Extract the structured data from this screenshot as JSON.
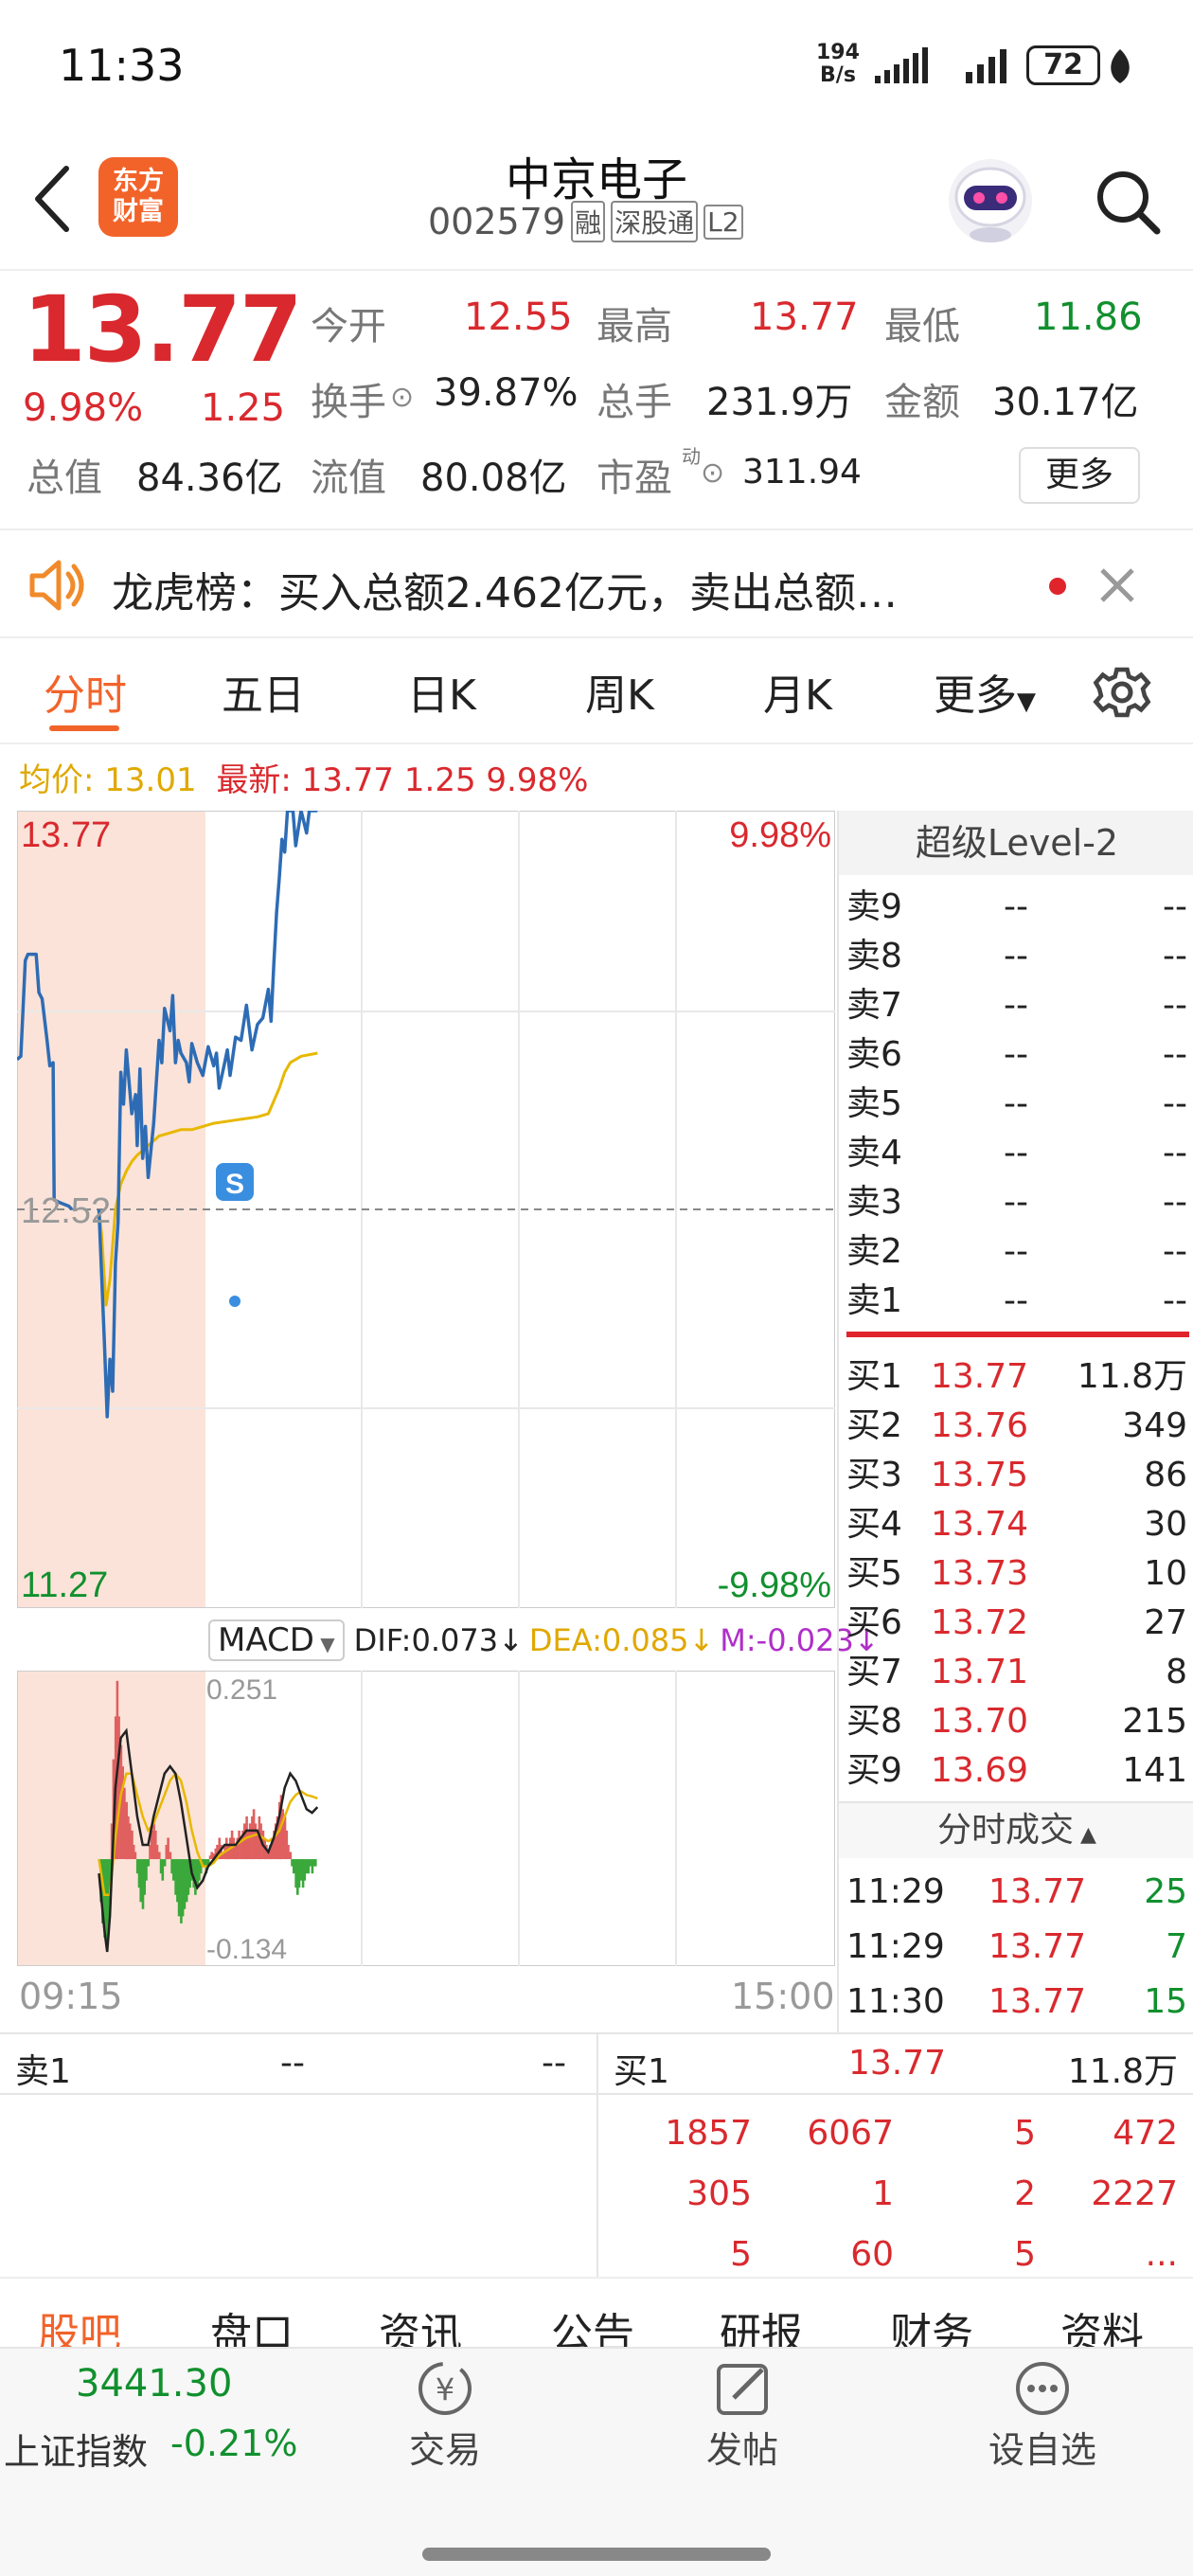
{
  "status": {
    "time": "11:33",
    "net_speed_num": "194",
    "net_speed_unit": "B/s",
    "battery": "72"
  },
  "header": {
    "title": "中京电子",
    "code": "002579",
    "tags": [
      "融",
      "深股通",
      "L2"
    ],
    "logo_line1": "东方",
    "logo_line2": "财富"
  },
  "quote": {
    "price": "13.77",
    "pct": "9.98%",
    "chg": "1.25",
    "open_label": "今开",
    "open": "12.55",
    "high_label": "最高",
    "high": "13.77",
    "low_label": "最低",
    "low": "11.86",
    "turnover_label": "换手",
    "turnover": "39.87%",
    "volume_label": "总手",
    "volume": "231.9万",
    "amount_label": "金额",
    "amount": "30.17亿",
    "mcap_label": "总值",
    "mcap": "84.36亿",
    "float_label": "流值",
    "float_cap": "80.08亿",
    "pe_label": "市盈",
    "pe_sup": "动",
    "pe": "311.94",
    "more_button": "更多"
  },
  "notice": {
    "text": "龙虎榜：买入总额2.462亿元，卖出总额…"
  },
  "tabs": {
    "items": [
      "分时",
      "五日",
      "日K",
      "周K",
      "月K"
    ],
    "more": "更多",
    "active_index": 0
  },
  "legend": {
    "avg_label": "均价:",
    "avg": "13.01",
    "latest_label": "最新:",
    "latest": "13.77",
    "chg": "1.25",
    "pct": "9.98%"
  },
  "chart_data": {
    "type": "line",
    "title": "",
    "price_axis": {
      "top": "13.77",
      "mid": "12.52",
      "bottom": "11.27",
      "top_pct": "9.98%",
      "bottom_pct": "-9.98%",
      "ylim": [
        11.27,
        13.77
      ],
      "prev_close": 12.52
    },
    "time_axis": {
      "start": "09:15",
      "end": "15:00"
    },
    "auction_price": [
      [
        0,
        12.99
      ],
      [
        0.7,
        13.0
      ],
      [
        1.5,
        13.3
      ],
      [
        2,
        13.32
      ],
      [
        3.5,
        13.32
      ],
      [
        4,
        13.2
      ],
      [
        4.6,
        13.18
      ],
      [
        5.5,
        13.05
      ],
      [
        6,
        12.97
      ],
      [
        6.6,
        12.98
      ],
      [
        6.8,
        12.55
      ],
      [
        8,
        12.54
      ],
      [
        9.5,
        12.53
      ],
      [
        10,
        12.52
      ]
    ],
    "price": [
      [
        15,
        12.52
      ],
      [
        16,
        12.1
      ],
      [
        16.5,
        11.87
      ],
      [
        17,
        12.05
      ],
      [
        17.5,
        11.95
      ],
      [
        18,
        12.35
      ],
      [
        18.5,
        12.48
      ],
      [
        19,
        12.95
      ],
      [
        19.5,
        12.85
      ],
      [
        20,
        13.02
      ],
      [
        21,
        12.82
      ],
      [
        21.7,
        12.88
      ],
      [
        22,
        12.72
      ],
      [
        22.5,
        12.96
      ],
      [
        23,
        12.68
      ],
      [
        23.5,
        12.78
      ],
      [
        24,
        12.62
      ],
      [
        25,
        12.79
      ],
      [
        26,
        13.05
      ],
      [
        26.5,
        12.98
      ],
      [
        27,
        13.15
      ],
      [
        28,
        13.08
      ],
      [
        28.5,
        13.19
      ],
      [
        29,
        12.98
      ],
      [
        29.5,
        13.05
      ],
      [
        30,
        13.01
      ],
      [
        31,
        12.98
      ],
      [
        31.5,
        12.92
      ],
      [
        32,
        13.04
      ],
      [
        33,
        12.98
      ],
      [
        34,
        12.94
      ],
      [
        35,
        13.03
      ],
      [
        36,
        12.97
      ],
      [
        36.5,
        13.01
      ],
      [
        37,
        12.9
      ],
      [
        38,
        12.98
      ],
      [
        38.5,
        13.02
      ],
      [
        39,
        12.94
      ],
      [
        40,
        13.06
      ],
      [
        41,
        13.05
      ],
      [
        42,
        13.16
      ],
      [
        43,
        13.02
      ],
      [
        44,
        13.1
      ],
      [
        45,
        13.12
      ],
      [
        46,
        13.21
      ],
      [
        46.5,
        13.11
      ],
      [
        47,
        13.29
      ],
      [
        47.5,
        13.45
      ],
      [
        48,
        13.56
      ],
      [
        48.5,
        13.68
      ],
      [
        49,
        13.64
      ],
      [
        49.5,
        13.77
      ],
      [
        50.5,
        13.77
      ],
      [
        51,
        13.66
      ],
      [
        52,
        13.77
      ],
      [
        53,
        13.7
      ],
      [
        53.5,
        13.77
      ],
      [
        55,
        13.77
      ]
    ],
    "avg_price": [
      [
        15,
        12.52
      ],
      [
        15.5,
        12.44
      ],
      [
        16,
        12.3
      ],
      [
        16.3,
        12.22
      ],
      [
        17,
        12.3
      ],
      [
        18,
        12.52
      ],
      [
        19,
        12.6
      ],
      [
        20,
        12.64
      ],
      [
        21,
        12.67
      ],
      [
        22,
        12.69
      ],
      [
        24,
        12.72
      ],
      [
        26,
        12.75
      ],
      [
        28,
        12.76
      ],
      [
        30,
        12.77
      ],
      [
        32,
        12.77
      ],
      [
        34,
        12.78
      ],
      [
        36,
        12.79
      ],
      [
        40,
        12.8
      ],
      [
        44,
        12.81
      ],
      [
        46,
        12.82
      ],
      [
        47,
        12.86
      ],
      [
        48,
        12.9
      ],
      [
        49,
        12.95
      ],
      [
        50,
        12.98
      ],
      [
        52,
        13.0
      ],
      [
        55,
        13.01
      ]
    ],
    "macd": {
      "label": "MACD",
      "dif_label": "DIF:",
      "dif": "0.073",
      "dea_label": "DEA:",
      "dea": "0.085",
      "m_label": "M:",
      "m": "-0.023",
      "top": "0.251",
      "bottom": "-0.134",
      "ylim": [
        -0.134,
        0.251
      ],
      "hist": [
        [
          15.3,
          -0.06
        ],
        [
          15.6,
          -0.09
        ],
        [
          16,
          -0.11
        ],
        [
          16.3,
          -0.12
        ],
        [
          16.6,
          -0.1
        ],
        [
          17,
          -0.06
        ],
        [
          17.3,
          0.05
        ],
        [
          17.6,
          0.14
        ],
        [
          18,
          0.2
        ],
        [
          18.3,
          0.25
        ],
        [
          18.6,
          0.2
        ],
        [
          19,
          0.16
        ],
        [
          19.3,
          0.13
        ],
        [
          19.6,
          0.1
        ],
        [
          20,
          0.08
        ],
        [
          20.3,
          0.06
        ],
        [
          20.6,
          0.05
        ],
        [
          21,
          0.04
        ],
        [
          21.3,
          0.02
        ],
        [
          21.6,
          0.01
        ],
        [
          22,
          -0.02
        ],
        [
          22.3,
          -0.04
        ],
        [
          22.6,
          -0.06
        ],
        [
          23,
          -0.07
        ],
        [
          23.3,
          -0.05
        ],
        [
          23.6,
          -0.03
        ],
        [
          24,
          -0.01
        ],
        [
          24.3,
          0.02
        ],
        [
          24.6,
          0.04
        ],
        [
          25,
          0.05
        ],
        [
          25.3,
          0.04
        ],
        [
          25.6,
          0.02
        ],
        [
          26,
          0.01
        ],
        [
          26.3,
          -0.02
        ],
        [
          26.6,
          -0.03
        ],
        [
          27,
          -0.01
        ],
        [
          27.3,
          0.02
        ],
        [
          27.6,
          0.03
        ],
        [
          28,
          0.01
        ],
        [
          28.3,
          -0.02
        ],
        [
          28.6,
          -0.03
        ],
        [
          29,
          -0.05
        ],
        [
          29.3,
          -0.06
        ],
        [
          29.6,
          -0.08
        ],
        [
          30,
          -0.09
        ],
        [
          30.3,
          -0.08
        ],
        [
          30.6,
          -0.07
        ],
        [
          31,
          -0.06
        ],
        [
          31.3,
          -0.05
        ],
        [
          31.6,
          -0.04
        ],
        [
          32,
          -0.03
        ],
        [
          32.3,
          -0.04
        ],
        [
          32.6,
          -0.05
        ],
        [
          33,
          -0.04
        ],
        [
          33.3,
          -0.03
        ],
        [
          33.6,
          -0.02
        ],
        [
          34,
          -0.01
        ],
        [
          34.3,
          -0.01
        ],
        [
          34.6,
          -0.02
        ],
        [
          35,
          -0.01
        ],
        [
          35.3,
          0.005
        ],
        [
          35.6,
          0.01
        ],
        [
          36,
          0.008
        ],
        [
          36.3,
          0.015
        ],
        [
          36.6,
          0.02
        ],
        [
          37,
          0.03
        ],
        [
          37.3,
          0.02
        ],
        [
          37.6,
          0.01
        ],
        [
          38,
          0.02
        ],
        [
          38.3,
          0.03
        ],
        [
          38.6,
          0.02
        ],
        [
          39,
          0.03
        ],
        [
          39.3,
          0.04
        ],
        [
          39.6,
          0.03
        ],
        [
          40,
          0.02
        ],
        [
          40.3,
          0.03
        ],
        [
          40.6,
          0.04
        ],
        [
          41,
          0.03
        ],
        [
          41.3,
          0.04
        ],
        [
          41.6,
          0.05
        ],
        [
          42,
          0.06
        ],
        [
          42.3,
          0.04
        ],
        [
          42.6,
          0.05
        ],
        [
          43,
          0.06
        ],
        [
          43.3,
          0.07
        ],
        [
          43.6,
          0.05
        ],
        [
          44,
          0.04
        ],
        [
          44.3,
          0.06
        ],
        [
          44.6,
          0.05
        ],
        [
          45,
          0.04
        ],
        [
          45.3,
          0.03
        ],
        [
          45.6,
          0.02
        ],
        [
          46,
          0.01
        ],
        [
          46.3,
          0.02
        ],
        [
          46.6,
          0.03
        ],
        [
          47,
          0.04
        ],
        [
          47.3,
          0.05
        ],
        [
          47.6,
          0.06
        ],
        [
          48,
          0.08
        ],
        [
          48.3,
          0.09
        ],
        [
          48.6,
          0.07
        ],
        [
          49,
          0.06
        ],
        [
          49.3,
          0.04
        ],
        [
          49.6,
          0.02
        ],
        [
          50,
          0.01
        ],
        [
          50.3,
          -0.01
        ],
        [
          50.6,
          -0.02
        ],
        [
          51,
          -0.04
        ],
        [
          51.3,
          -0.05
        ],
        [
          51.6,
          -0.04
        ],
        [
          52,
          -0.03
        ],
        [
          52.3,
          -0.04
        ],
        [
          52.6,
          -0.03
        ],
        [
          53,
          -0.02
        ],
        [
          53.3,
          -0.02
        ],
        [
          53.6,
          -0.01
        ],
        [
          54,
          -0.02
        ],
        [
          54.3,
          -0.01
        ],
        [
          54.6,
          -0.01
        ]
      ],
      "dif_line": [
        [
          15,
          -0.02
        ],
        [
          16,
          -0.1
        ],
        [
          16.5,
          -0.13
        ],
        [
          17,
          -0.08
        ],
        [
          18,
          0.1
        ],
        [
          19,
          0.17
        ],
        [
          20,
          0.18
        ],
        [
          21,
          0.12
        ],
        [
          22,
          0.06
        ],
        [
          23,
          0.02
        ],
        [
          24,
          0.02
        ],
        [
          25,
          0.06
        ],
        [
          26,
          0.09
        ],
        [
          27,
          0.12
        ],
        [
          28,
          0.13
        ],
        [
          29,
          0.12
        ],
        [
          30,
          0.08
        ],
        [
          31,
          0.03
        ],
        [
          32,
          -0.02
        ],
        [
          33,
          -0.04
        ],
        [
          34,
          -0.03
        ],
        [
          35,
          -0.01
        ],
        [
          36,
          0.0
        ],
        [
          37,
          0.01
        ],
        [
          38,
          0.02
        ],
        [
          40,
          0.02
        ],
        [
          42,
          0.04
        ],
        [
          44,
          0.04
        ],
        [
          45,
          0.02
        ],
        [
          46,
          0.01
        ],
        [
          47,
          0.03
        ],
        [
          48,
          0.06
        ],
        [
          49,
          0.1
        ],
        [
          50,
          0.12
        ],
        [
          51,
          0.11
        ],
        [
          52,
          0.09
        ],
        [
          53,
          0.07
        ],
        [
          54,
          0.065
        ],
        [
          55,
          0.073
        ]
      ],
      "dea_line": [
        [
          15,
          0.0
        ],
        [
          16,
          -0.05
        ],
        [
          17,
          -0.05
        ],
        [
          18,
          0.03
        ],
        [
          19,
          0.09
        ],
        [
          20,
          0.12
        ],
        [
          21,
          0.12
        ],
        [
          22,
          0.09
        ],
        [
          23,
          0.06
        ],
        [
          24,
          0.04
        ],
        [
          25,
          0.05
        ],
        [
          26,
          0.07
        ],
        [
          27,
          0.09
        ],
        [
          28,
          0.11
        ],
        [
          29,
          0.12
        ],
        [
          30,
          0.11
        ],
        [
          31,
          0.08
        ],
        [
          32,
          0.04
        ],
        [
          33,
          0.01
        ],
        [
          34,
          -0.01
        ],
        [
          35,
          -0.01
        ],
        [
          36,
          -0.005
        ],
        [
          37,
          0.005
        ],
        [
          38,
          0.01
        ],
        [
          40,
          0.02
        ],
        [
          42,
          0.03
        ],
        [
          44,
          0.035
        ],
        [
          45,
          0.03
        ],
        [
          46,
          0.025
        ],
        [
          47,
          0.03
        ],
        [
          48,
          0.04
        ],
        [
          49,
          0.06
        ],
        [
          50,
          0.08
        ],
        [
          51,
          0.09
        ],
        [
          52,
          0.095
        ],
        [
          53,
          0.09
        ],
        [
          54,
          0.088
        ],
        [
          55,
          0.085
        ]
      ]
    }
  },
  "order_book": {
    "title": "超级Level-2",
    "sells": [
      {
        "label": "卖9",
        "price": "--",
        "vol": "--"
      },
      {
        "label": "卖8",
        "price": "--",
        "vol": "--"
      },
      {
        "label": "卖7",
        "price": "--",
        "vol": "--"
      },
      {
        "label": "卖6",
        "price": "--",
        "vol": "--"
      },
      {
        "label": "卖5",
        "price": "--",
        "vol": "--"
      },
      {
        "label": "卖4",
        "price": "--",
        "vol": "--"
      },
      {
        "label": "卖3",
        "price": "--",
        "vol": "--"
      },
      {
        "label": "卖2",
        "price": "--",
        "vol": "--"
      },
      {
        "label": "卖1",
        "price": "--",
        "vol": "--"
      }
    ],
    "buys": [
      {
        "label": "买1",
        "price": "13.77",
        "vol": "11.8万"
      },
      {
        "label": "买2",
        "price": "13.76",
        "vol": "349"
      },
      {
        "label": "买3",
        "price": "13.75",
        "vol": "86"
      },
      {
        "label": "买4",
        "price": "13.74",
        "vol": "30"
      },
      {
        "label": "买5",
        "price": "13.73",
        "vol": "10"
      },
      {
        "label": "买6",
        "price": "13.72",
        "vol": "27"
      },
      {
        "label": "买7",
        "price": "13.71",
        "vol": "8"
      },
      {
        "label": "买8",
        "price": "13.70",
        "vol": "215"
      },
      {
        "label": "买9",
        "price": "13.69",
        "vol": "141"
      }
    ],
    "ticks_title": "分时成交",
    "ticks": [
      {
        "time": "11:29",
        "price": "13.77",
        "vol": "25"
      },
      {
        "time": "11:29",
        "price": "13.77",
        "vol": "7"
      },
      {
        "time": "11:30",
        "price": "13.77",
        "vol": "15"
      }
    ]
  },
  "queue": {
    "sell_label": "卖1",
    "sell_price": "--",
    "sell_vol": "--",
    "buy_label": "买1",
    "buy_price": "13.77",
    "buy_vol": "11.8万",
    "rows": [
      [
        "1857",
        "6067",
        "5",
        "472"
      ],
      [
        "305",
        "1",
        "2",
        "2227"
      ],
      [
        "5",
        "60",
        "5",
        "..."
      ]
    ]
  },
  "bottom_tabs": {
    "items": [
      "股吧",
      "盘口",
      "资讯",
      "公告",
      "研报",
      "财务",
      "资料"
    ]
  },
  "bottom_bar": {
    "index_value": "3441.30",
    "index_name": "上证指数",
    "index_pct": "-0.21%",
    "trade": "交易",
    "post": "发帖",
    "watchlist": "设自选",
    "trade_glyph": "¥"
  }
}
